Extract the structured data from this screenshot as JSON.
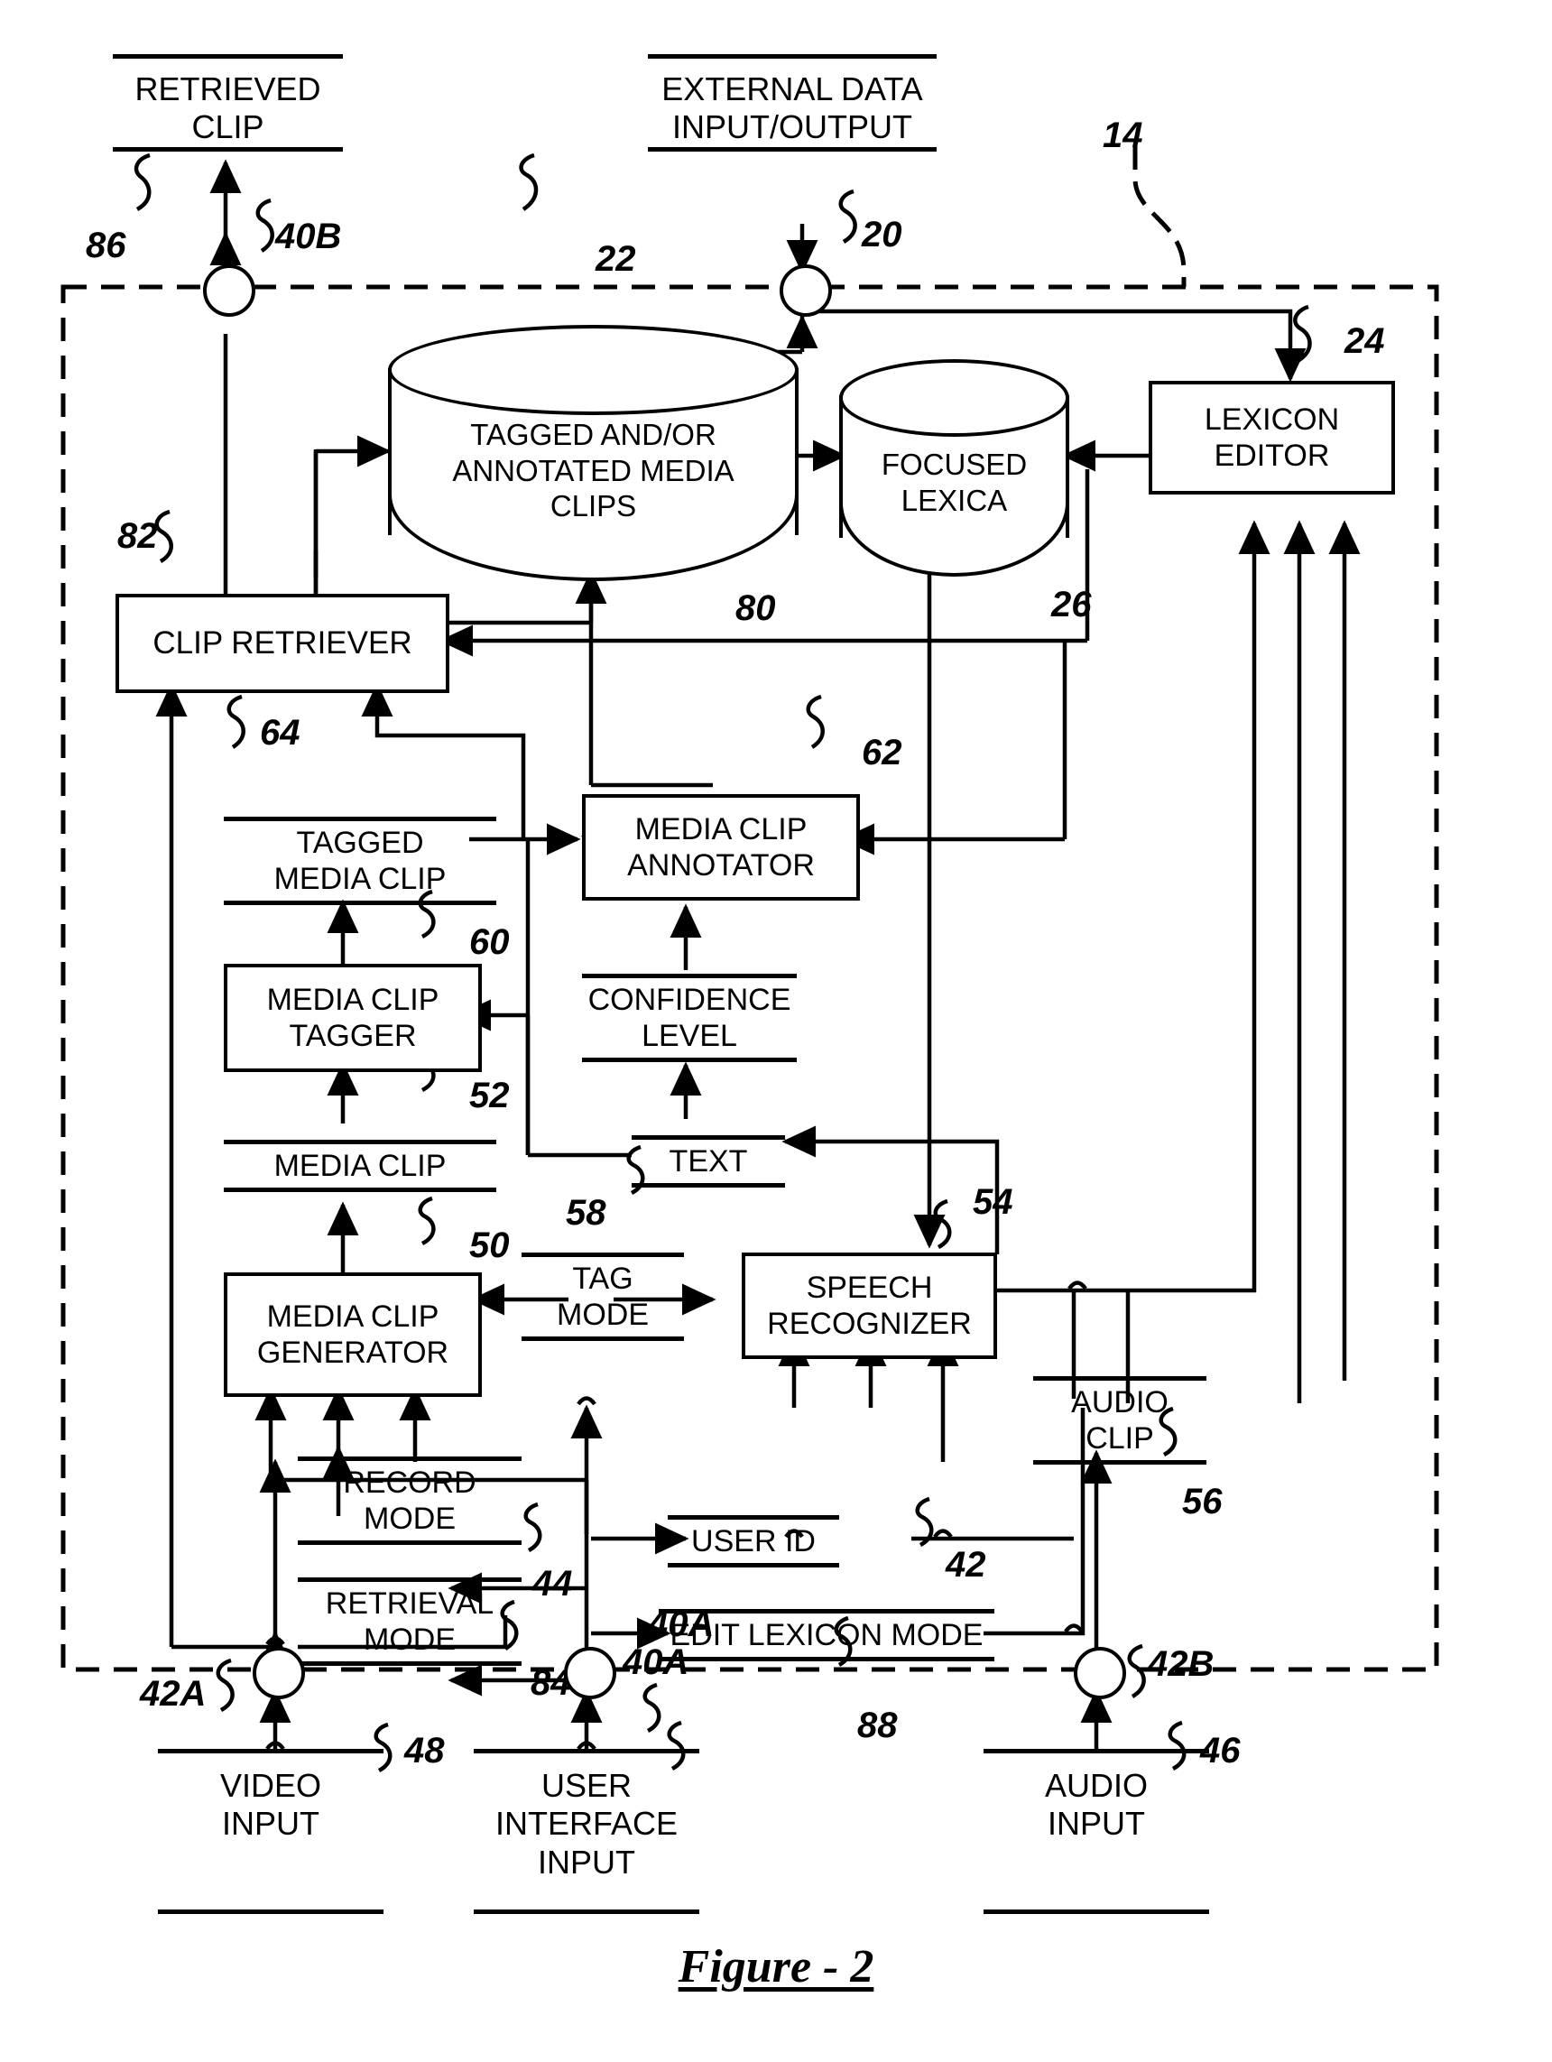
{
  "figure": {
    "caption": "Figure - 2"
  },
  "system": {
    "boundary_ref": "14"
  },
  "io_terminals": [
    {
      "name": "retrieved-clip",
      "label": "RETRIEVED\nCLIP",
      "refs": [
        "86",
        "40B"
      ]
    },
    {
      "name": "external-data-io",
      "label": "EXTERNAL DATA\nINPUT/OUTPUT",
      "refs": [
        "22",
        "20"
      ]
    },
    {
      "name": "video-input",
      "label": "VIDEO\nINPUT",
      "refs": [
        "42A",
        "48"
      ]
    },
    {
      "name": "user-interface-input",
      "label": "USER\nINTERFACE\nINPUT",
      "refs": [
        "40A"
      ]
    },
    {
      "name": "audio-input",
      "label": "AUDIO\nINPUT",
      "refs": [
        "42B",
        "46"
      ]
    }
  ],
  "databases": [
    {
      "name": "tagged-annotated-media-clips",
      "label": "TAGGED AND/OR\nANNOTATED MEDIA\nCLIPS",
      "ref": "80"
    },
    {
      "name": "focused-lexica",
      "label": "FOCUSED\nLEXICA",
      "ref": "26"
    }
  ],
  "modules": [
    {
      "name": "lexicon-editor",
      "label": "LEXICON\nEDITOR",
      "ref": "24"
    },
    {
      "name": "clip-retriever",
      "label": "CLIP RETRIEVER",
      "ref": "82"
    },
    {
      "name": "media-clip-annotator",
      "label": "MEDIA CLIP\nANNOTATOR",
      "ref": "62"
    },
    {
      "name": "media-clip-tagger",
      "label": "MEDIA CLIP\nTAGGER",
      "ref": "60"
    },
    {
      "name": "media-clip-generator",
      "label": "MEDIA CLIP\nGENERATOR",
      "ref": "50"
    },
    {
      "name": "speech-recognizer",
      "label": "SPEECH\nRECOGNIZER",
      "ref": "54"
    }
  ],
  "signals": [
    {
      "name": "tagged-media-clip",
      "label": "TAGGED\nMEDIA CLIP",
      "ref": "64"
    },
    {
      "name": "confidence-level",
      "label": "CONFIDENCE\nLEVEL",
      "ref": ""
    },
    {
      "name": "media-clip",
      "label": "MEDIA CLIP",
      "ref": "52"
    },
    {
      "name": "text",
      "label": "TEXT",
      "ref": "58"
    },
    {
      "name": "tag-mode",
      "label": "TAG\nMODE",
      "ref": ""
    },
    {
      "name": "audio-clip",
      "label": "AUDIO\nCLIP",
      "ref": "56"
    },
    {
      "name": "record-mode",
      "label": "RECORD\nMODE",
      "ref": "44"
    },
    {
      "name": "retrieval-mode",
      "label": "RETRIEVAL\nMODE",
      "ref": "84"
    },
    {
      "name": "user-id",
      "label": "USER ID",
      "ref": "42"
    },
    {
      "name": "edit-lexicon-mode",
      "label": "EDIT LEXICON MODE",
      "ref": "88"
    }
  ],
  "labels": {
    "retrieved_clip": "RETRIEVED\nCLIP",
    "external_data_io": "EXTERNAL DATA\nINPUT/OUTPUT",
    "tagged_annotated_media_clips": "TAGGED AND/OR\nANNOTATED MEDIA\nCLIPS",
    "focused_lexica": "FOCUSED\nLEXICA",
    "lexicon_editor": "LEXICON\nEDITOR",
    "clip_retriever": "CLIP RETRIEVER",
    "tagged_media_clip": "TAGGED\nMEDIA CLIP",
    "media_clip_annotator": "MEDIA CLIP\nANNOTATOR",
    "media_clip_tagger": "MEDIA CLIP\nTAGGER",
    "confidence_level": "CONFIDENCE\nLEVEL",
    "media_clip": "MEDIA CLIP",
    "text": "TEXT",
    "media_clip_generator": "MEDIA CLIP\nGENERATOR",
    "tag_mode": "TAG\nMODE",
    "speech_recognizer": "SPEECH\nRECOGNIZER",
    "audio_clip": "AUDIO\nCLIP",
    "record_mode": "RECORD\nMODE",
    "user_id": "USER ID",
    "edit_lexicon_mode": "EDIT LEXICON MODE",
    "retrieval_mode": "RETRIEVAL\nMODE",
    "video_input": "VIDEO\nINPUT",
    "user_interface_input": "USER\nINTERFACE\nINPUT",
    "audio_input": "AUDIO\nINPUT"
  },
  "refs": {
    "r14": "14",
    "r20": "20",
    "r22": "22",
    "r24": "24",
    "r26": "26",
    "r40a": "40A",
    "r40b": "40B",
    "r42": "42",
    "r42a": "42A",
    "r42b": "42B",
    "r44": "44",
    "r46": "46",
    "r48": "48",
    "r50": "50",
    "r52": "52",
    "r54": "54",
    "r56": "56",
    "r58": "58",
    "r60": "60",
    "r62": "62",
    "r64": "64",
    "r80": "80",
    "r82": "82",
    "r84": "84",
    "r86": "86",
    "r88": "88"
  },
  "colors": {
    "ink": "#000000",
    "paper": "#ffffff"
  }
}
